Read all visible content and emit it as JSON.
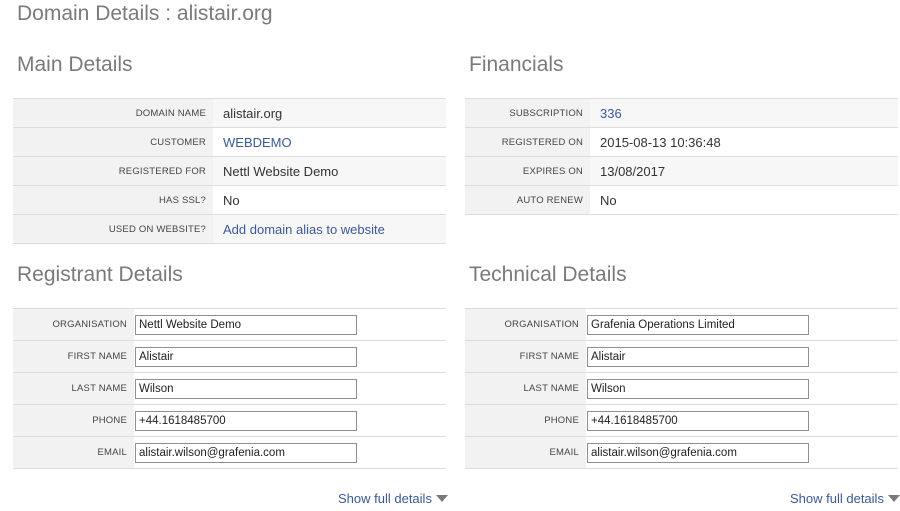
{
  "page": {
    "title": "Domain Details : alistair.org"
  },
  "main_details": {
    "title": "Main Details",
    "rows": [
      {
        "label": "Domain Name",
        "value": "alistair.org"
      },
      {
        "label": "Customer",
        "value": "WEBDEMO"
      },
      {
        "label": "Registered For",
        "value": "Nettl Website Demo"
      },
      {
        "label": "Has SSL?",
        "value": "No"
      },
      {
        "label": "Used On Website?",
        "value": "Add domain alias to website"
      }
    ]
  },
  "financials": {
    "title": "Financials",
    "rows": [
      {
        "label": "Subscription",
        "value": "336"
      },
      {
        "label": "Registered On",
        "value": "2015-08-13 10:36:48"
      },
      {
        "label": "Expires On",
        "value": "13/08/2017"
      },
      {
        "label": "Auto Renew",
        "value": "No"
      }
    ]
  },
  "registrant": {
    "title": "Registrant Details",
    "fields": [
      {
        "label": "Organisation",
        "value": "Nettl Website Demo"
      },
      {
        "label": "First Name",
        "value": "Alistair"
      },
      {
        "label": "Last Name",
        "value": "Wilson"
      },
      {
        "label": "Phone",
        "value": "+44.1618485700"
      },
      {
        "label": "Email",
        "value": "alistair.wilson@grafenia.com"
      }
    ],
    "show_full": "Show full details"
  },
  "technical": {
    "title": "Technical Details",
    "fields": [
      {
        "label": "Organisation",
        "value": "Grafenia Operations Limited"
      },
      {
        "label": "First Name",
        "value": "Alistair"
      },
      {
        "label": "Last Name",
        "value": "Wilson"
      },
      {
        "label": "Phone",
        "value": "+44.1618485700"
      },
      {
        "label": "Email",
        "value": "alistair.wilson@grafenia.com"
      }
    ],
    "show_full": "Show full details"
  }
}
